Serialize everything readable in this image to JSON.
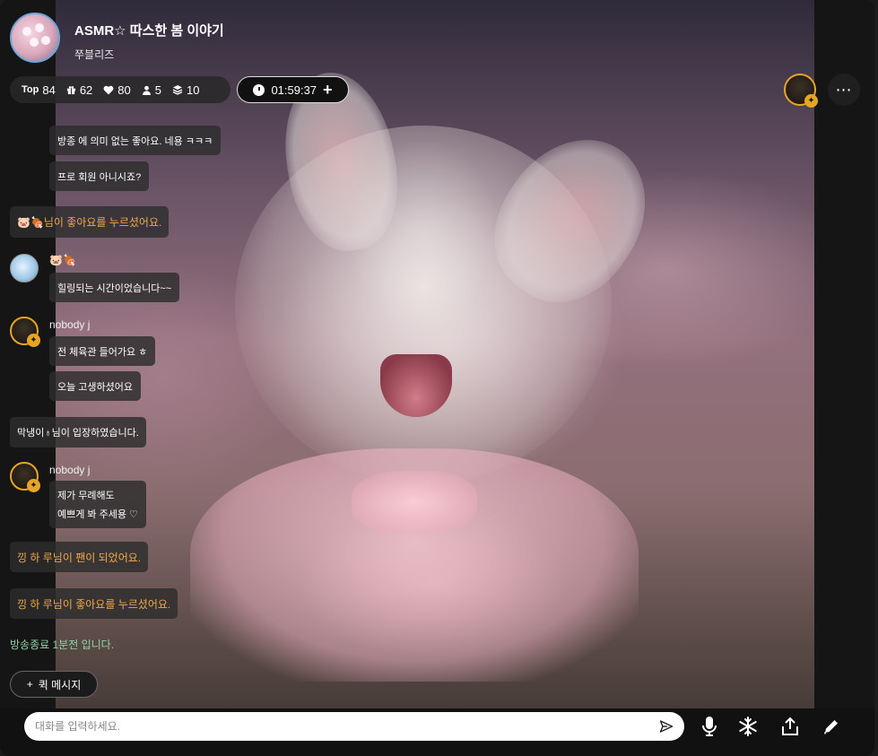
{
  "header": {
    "title": "ASMR☆ 따스한 봄 이야기",
    "streamer": "쭈블리즈"
  },
  "stats": {
    "top_label": "Top",
    "top_value": "84",
    "gift_value": "62",
    "like_value": "80",
    "viewer_value": "5",
    "layer_value": "10"
  },
  "timer": {
    "time": "01:59:37",
    "plus": "+"
  },
  "more": "⋯",
  "chat": {
    "m1": "방종 에 의미 없는 좋아요. 네용 ㅋㅋㅋ",
    "m2": "프로 회원 아니시죠?",
    "sys1": "🐷🍖님이 좋아요를 누르셨어요.",
    "user2_name": "🐷🍖",
    "m3": "힐링되는 시간이었습니다~~",
    "user3_name": "nobody j",
    "m4": "전 체육관 들어가요 ㅎ",
    "m5": "오늘 고생하셨어요",
    "sys2": "막냉이♁님이 입장하였습니다.",
    "user4_name": "nobody j",
    "m6_line1": "제가 무례해도",
    "m6_line2": "예쁘게 봐 주세용 ♡",
    "sys3": "낑 하 루님이 팬이 되었어요.",
    "sys4": "낑 하 루님이 좋아요를 누르셨어요.",
    "notice": "방송종료 1분전 입니다."
  },
  "quick_message": {
    "plus": "+",
    "label": "퀵 메시지"
  },
  "input": {
    "placeholder": "대화를 입력하세요."
  },
  "icons": {
    "send": "send-icon",
    "mic": "mic-icon",
    "snowflake": "snowflake-icon",
    "share": "share-icon",
    "pencil": "pencil-icon"
  },
  "colors": {
    "accent_orange": "#f0a84a",
    "notice_green": "#8fd1a8",
    "host_ring": "#e8a524"
  }
}
